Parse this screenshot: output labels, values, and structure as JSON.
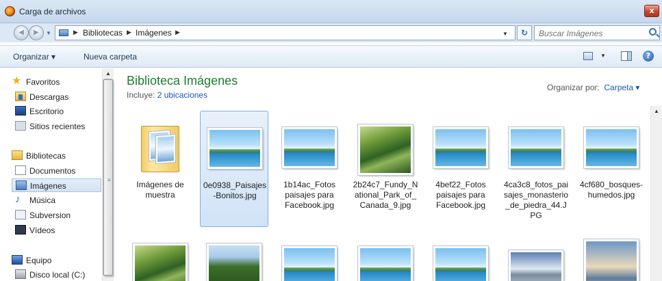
{
  "window": {
    "title": "Carga de archivos",
    "close_label": "x"
  },
  "address": {
    "crumbs": [
      "Bibliotecas",
      "Imágenes"
    ],
    "search_placeholder": "Buscar Imágenes"
  },
  "toolbar": {
    "organize_label": "Organizar ▾",
    "new_folder_label": "Nueva carpeta",
    "help_label": "?"
  },
  "sidebar": {
    "favorites": {
      "label": "Favoritos",
      "items": [
        "Descargas",
        "Escritorio",
        "Sitios recientes"
      ]
    },
    "libraries": {
      "label": "Bibliotecas",
      "items": [
        "Documentos",
        "Imágenes",
        "Música",
        "Subversion",
        "Vídeos"
      ]
    },
    "computer": {
      "label": "Equipo",
      "items": [
        "Disco local (C:)"
      ]
    }
  },
  "main": {
    "title": "Biblioteca Imágenes",
    "includes_label": "Incluye:",
    "includes_link": "2 ubicaciones",
    "arrange_label": "Organizar por:",
    "arrange_value": "Carpeta ▾",
    "files": [
      {
        "name": "Imágenes de muestra",
        "kind": "folder"
      },
      {
        "name": "0e0938_Paisajes-Bonitos.jpg",
        "kind": "image",
        "selected": true
      },
      {
        "name": "1b14ac_Fotos paisajes para Facebook.jpg",
        "kind": "image"
      },
      {
        "name": "2b24c7_Fundy_National_Park_of_Canada_9.jpg",
        "kind": "image"
      },
      {
        "name": "4bef22_Fotos paisajes para Facebook.jpg",
        "kind": "image"
      },
      {
        "name": "4ca3c8_fotos_paisajes_monasterio_de_piedra_44.JPG",
        "kind": "image"
      },
      {
        "name": "4cf680_bosques-humedos.jpg",
        "kind": "image"
      }
    ]
  }
}
